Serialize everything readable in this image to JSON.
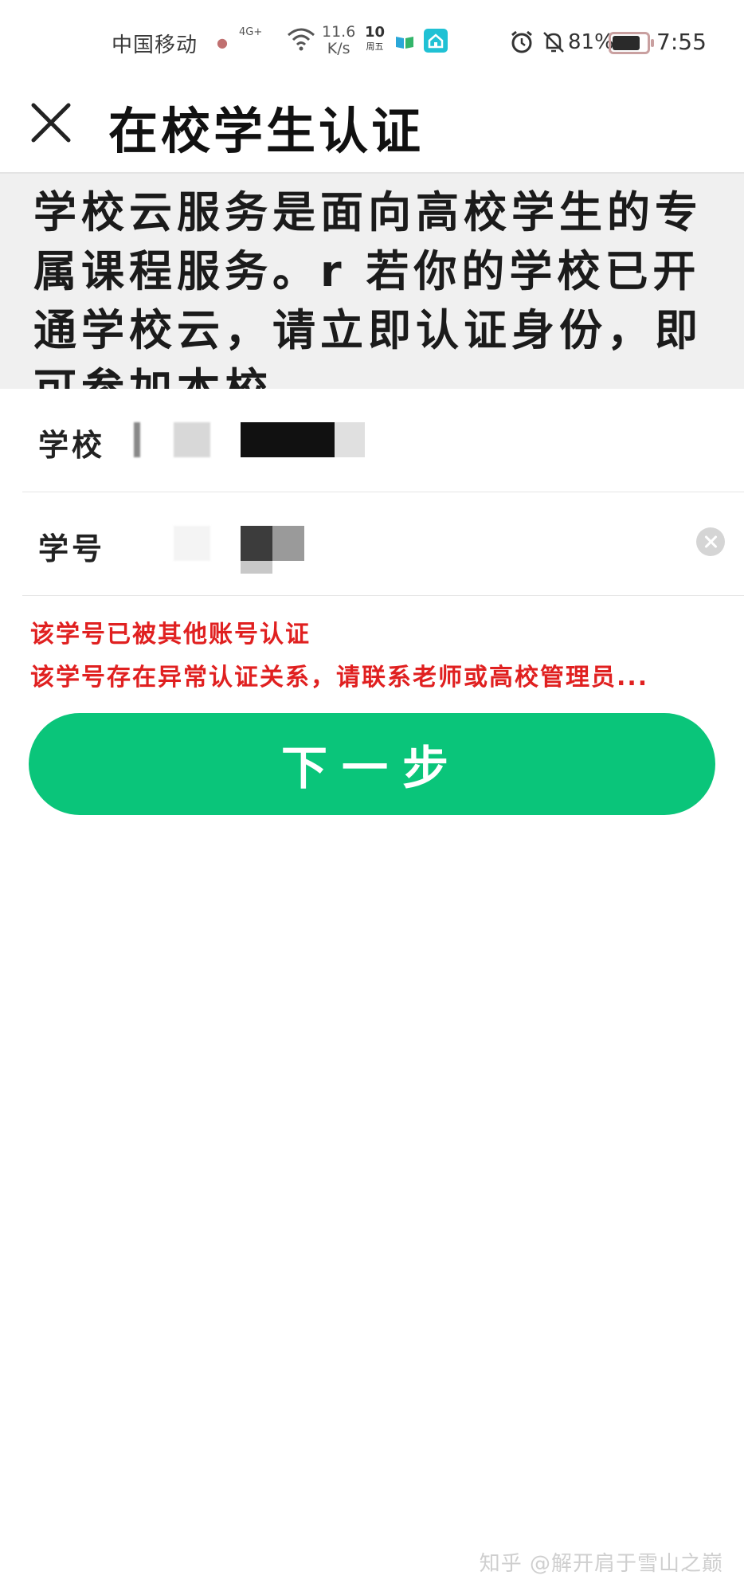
{
  "status_bar": {
    "carrier": "中国移动",
    "network": "4G+",
    "speed": "11.6",
    "speed_unit": "K/s",
    "date_day": "10",
    "date_week": "周五",
    "battery": "81%",
    "time": "7:55"
  },
  "nav": {
    "title": "在校学生认证"
  },
  "intro": {
    "text": "学校云服务是面向高校学生的专属课程服务。r 若你的学校已开通学校云，请立即认证身份，即可参加本校"
  },
  "form": {
    "school_label": "学校",
    "student_id_label": "学号"
  },
  "errors": [
    "该学号已被其他账号认证",
    "该学号存在异常认证关系，请联系老师或高校管理员..."
  ],
  "next_button": {
    "label": "下一步",
    "color": "#0ac57a"
  },
  "watermark": "知乎 @解开肩于雪山之巅"
}
